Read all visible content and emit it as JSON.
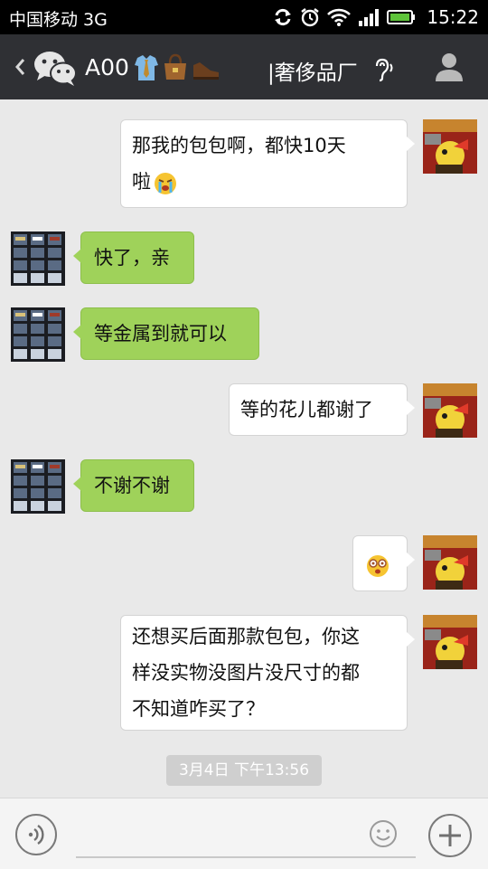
{
  "status_bar": {
    "carrier": "中国移动 3G",
    "time": "15:22",
    "icons": [
      "sync-icon",
      "alarm-icon",
      "wifi-icon",
      "signal-icon",
      "battery-icon"
    ]
  },
  "header": {
    "title": "A00",
    "title_emojis": [
      "shirt-tie-icon",
      "handbag-icon",
      "shoe-icon"
    ],
    "subtitle": "|奢侈品厂",
    "icons": [
      "back-icon",
      "wechat-logo-icon",
      "ear-icon",
      "profile-icon"
    ]
  },
  "messages": [
    {
      "side": "out",
      "lines": [
        "那我的包包啊，都快10天",
        "啦"
      ],
      "emoji": "crying-face"
    },
    {
      "side": "in",
      "text": "快了，亲"
    },
    {
      "side": "in",
      "text": "等金属到就可以"
    },
    {
      "side": "out",
      "text": "等的花儿都谢了"
    },
    {
      "side": "in",
      "text": "不谢不谢"
    },
    {
      "side": "out",
      "emoji": "dizzy-face"
    },
    {
      "side": "out",
      "lines": [
        "还想买后面那款包包，你这",
        "样没实物没图片没尺寸的都",
        "不知道咋买了？"
      ]
    }
  ],
  "timestamp": "3月4日 下午13:56",
  "input_bar": {
    "placeholder": "",
    "icons": [
      "voice-icon",
      "emoji-icon",
      "plus-icon"
    ]
  },
  "colors": {
    "header_bg": "#2f3034",
    "chat_bg": "#e9e9e9",
    "incoming_bubble": "#9fd25a",
    "outgoing_bubble": "#ffffff",
    "timestamp_bg": "#cfcfcf"
  }
}
